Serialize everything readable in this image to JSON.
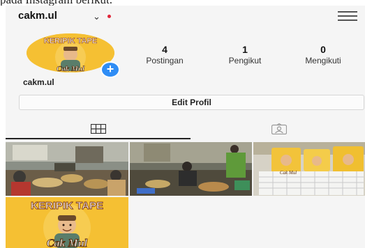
{
  "caption": "pada Instagram berikut.",
  "header": {
    "username": "cakm.ul",
    "chevron": "⌄",
    "menu_icon": "hamburger-menu-icon"
  },
  "profile": {
    "name": "cakm.ul",
    "avatar_brand": "KERIPIK TAPE",
    "avatar_sub": "Cak Mul"
  },
  "stats": [
    {
      "value": "4",
      "label": "Postingan"
    },
    {
      "value": "1",
      "label": "Pengikut"
    },
    {
      "value": "0",
      "label": "Mengikuti"
    }
  ],
  "edit_profile_label": "Edit Profil",
  "tabs": [
    {
      "icon": "grid-icon",
      "active": true
    },
    {
      "icon": "tagged-person-icon",
      "active": false
    }
  ],
  "posts": [
    {
      "kind": "photo",
      "icon": "workshop-photo"
    },
    {
      "kind": "photo",
      "icon": "production-photo"
    },
    {
      "kind": "photo",
      "icon": "packaged-products-photo",
      "text": "Cak Mul"
    },
    {
      "kind": "logo",
      "brand": "KERIPIK TAPE",
      "sub": "Cak Mul"
    }
  ],
  "colors": {
    "accent_blue": "#2f8df5",
    "notification_red": "#e0263a",
    "logo_yellow": "#f5c033"
  }
}
